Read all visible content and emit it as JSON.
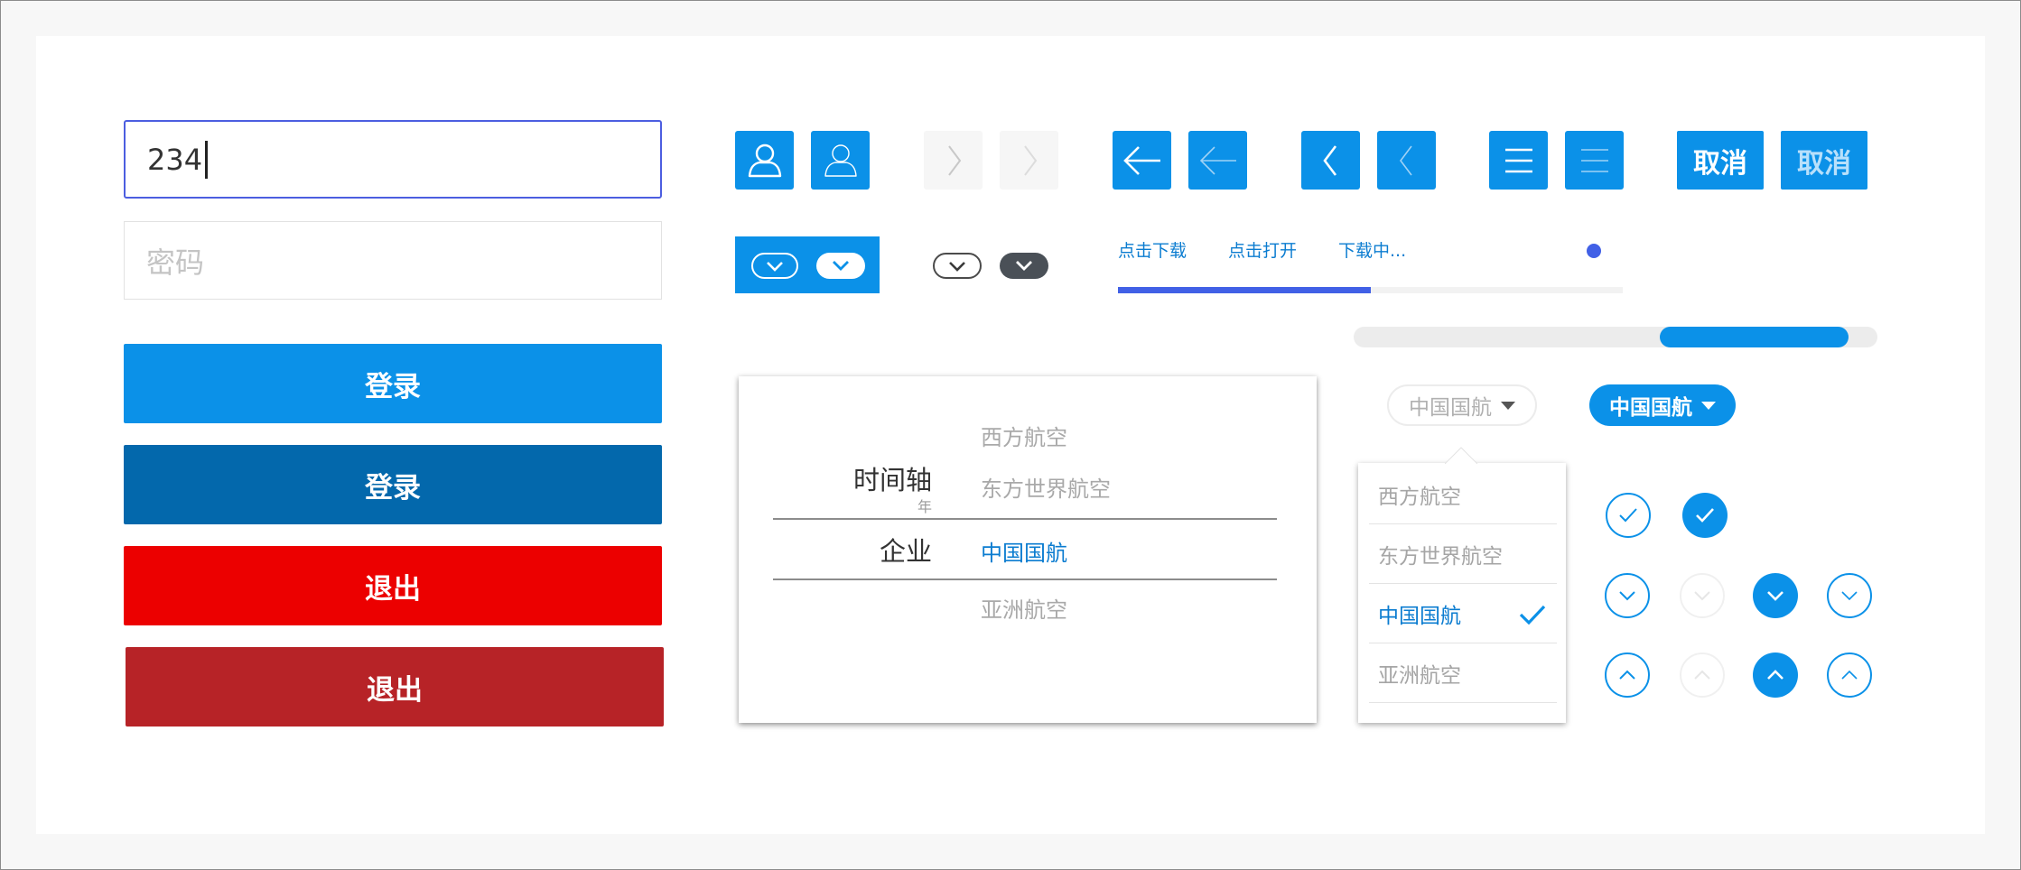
{
  "login": {
    "username_value": "234",
    "password_placeholder": "密码",
    "login_label": "登录",
    "logout_label": "退出"
  },
  "toolbar": {
    "cancel_label": "取消"
  },
  "download": {
    "tabs": [
      "点击下载",
      "点击打开",
      "下载中..."
    ],
    "tab_progress": 0.5,
    "bar_progress": 0.36
  },
  "picker": {
    "group_label": "时间轴",
    "group_sub": "年",
    "row_label": "企业",
    "options": [
      "西方航空",
      "东方世界航空",
      "中国国航",
      "亚洲航空"
    ],
    "selected": "中国国航"
  },
  "dropdown": {
    "value": "中国国航",
    "items": [
      "西方航空",
      "东方世界航空",
      "中国国航",
      "亚洲航空"
    ],
    "selected": "中国国航"
  },
  "colors": {
    "primary": "#0b91e8",
    "primary_dark": "#0368ac",
    "danger": "#ec0000",
    "danger_dark": "#b72327",
    "progress": "#4160e6"
  },
  "icons": [
    "user-icon",
    "chevron-right-icon",
    "arrow-left-icon",
    "chevron-left-icon",
    "menu-icon",
    "chevron-down-icon",
    "chevron-up-icon",
    "check-icon"
  ]
}
